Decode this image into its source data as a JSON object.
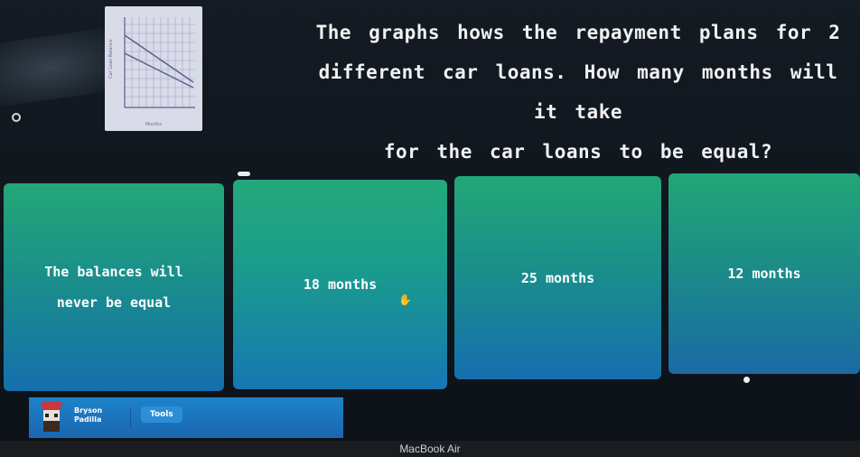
{
  "question": {
    "text_line1": "The graphs hows the repayment plans for 2",
    "text_line2": "different car loans. How many months will it take",
    "text_line3": "for the car loans to be equal?"
  },
  "graph_thumbnail": {
    "ylabel": "Car Loan Balance",
    "xlabel": "Months",
    "series_count": 2
  },
  "answers": [
    {
      "label_line1": "The balances will",
      "label_line2": "never be equal"
    },
    {
      "label": "18 months"
    },
    {
      "label": "25 months"
    },
    {
      "label": "12 months"
    }
  ],
  "player": {
    "first_name": "Bryson",
    "last_name": "Padilla"
  },
  "toolbar": {
    "tools_label": "Tools"
  },
  "device": {
    "label": "MacBook Air"
  }
}
